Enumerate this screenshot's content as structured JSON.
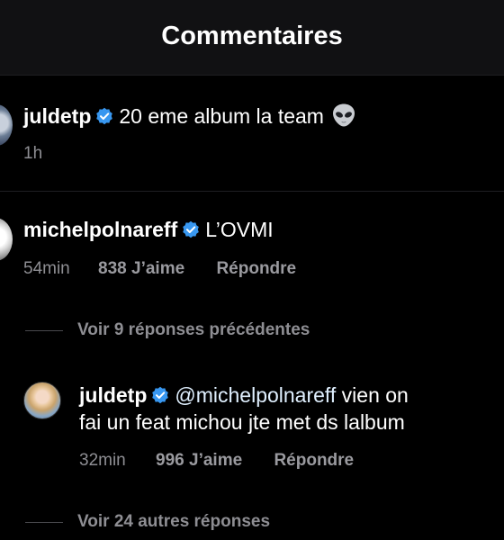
{
  "header": {
    "title": "Commentaires"
  },
  "comments": [
    {
      "username": "juldetp",
      "text": "20 eme album la team",
      "time": "1h",
      "emoji": "alien-emoji"
    },
    {
      "username": "michelpolnareff",
      "text": "L’OVMI",
      "time": "54min",
      "likes": "838 J’aime",
      "reply_label": "Répondre",
      "view_replies": "Voir 9 réponses précédentes",
      "reply": {
        "username": "juldetp",
        "mention": "@michelpolnareff",
        "text_line1": " vien on",
        "text_line2": "fai un feat michou jte met ds lalbum",
        "time": "32min",
        "likes": "996 J’aime",
        "reply_label": "Répondre"
      },
      "more_replies": "Voir 24 autres réponses"
    }
  ],
  "colors": {
    "background": "#000000",
    "header": "#111113",
    "verified": "#3897f0",
    "secondary_text": "#8e8e93"
  },
  "icons": [
    "verified-badge-icon",
    "alien-emoji"
  ]
}
